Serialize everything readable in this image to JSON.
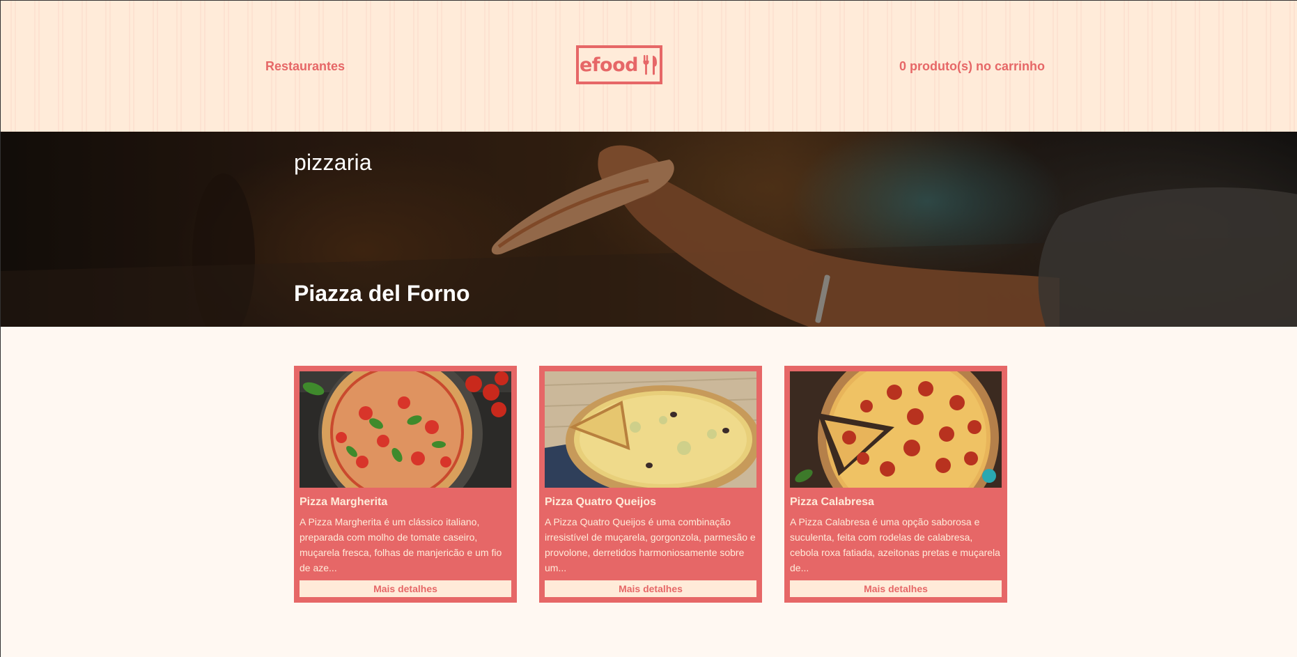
{
  "header": {
    "nav_link": "Restaurantes",
    "logo_text": "efood",
    "cart_text": "0 produto(s) no carrinho"
  },
  "hero": {
    "category": "pizzaria",
    "restaurant_name": "Piazza del Forno"
  },
  "products": [
    {
      "name": "Pizza Margherita",
      "description": "A Pizza Margherita é um clássico italiano, preparada com molho de tomate caseiro, muçarela fresca, folhas de manjericão e um fio de aze...",
      "button": "Mais detalhes"
    },
    {
      "name": "Pizza Quatro Queijos",
      "description": "A Pizza Quatro Queijos é uma combinação irresistível de muçarela, gorgonzola, parmesão e provolone, derretidos harmoniosamente sobre um...",
      "button": "Mais detalhes"
    },
    {
      "name": "Pizza Calabresa",
      "description": "A Pizza Calabresa é uma opção saborosa e suculenta, feita com rodelas de calabresa, cebola roxa fatiada, azeitonas pretas e muçarela de...",
      "button": "Mais detalhes"
    }
  ],
  "colors": {
    "primary": "#E66767",
    "header_bg": "#FFEBD9",
    "page_bg": "#FFF8F2",
    "card_text": "#FFEBD9"
  }
}
